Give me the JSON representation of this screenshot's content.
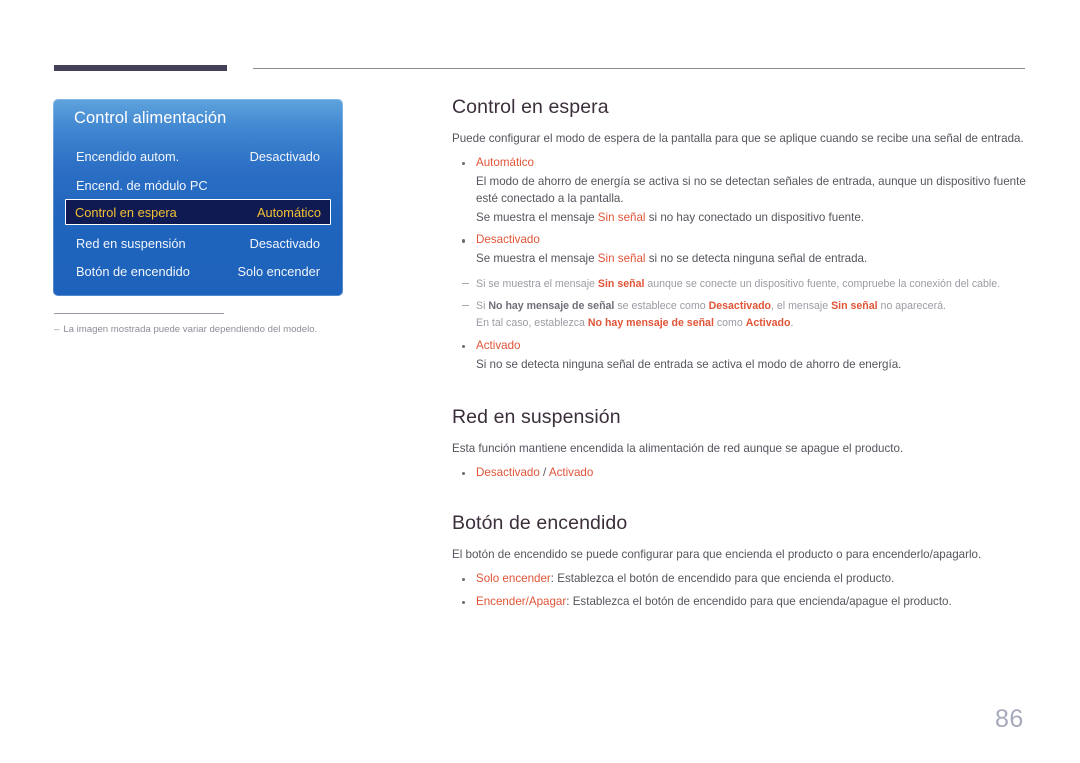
{
  "header": {
    "rule_accent_color": "#434058",
    "rule_line_color": "#8b8b92"
  },
  "osd_panel": {
    "title": "Control alimentación",
    "accent_color": "#1d62bc",
    "selected_background": "#101a52",
    "selected_text_color": "#f2c033",
    "rows": [
      {
        "label": "Encendido autom.",
        "value": "Desactivado",
        "selected": false
      },
      {
        "label": "Encend. de módulo PC",
        "value": "",
        "selected": false
      },
      {
        "label": "Control en espera",
        "value": "Automático",
        "selected": true
      },
      {
        "label": "Red en suspensión",
        "value": "Desactivado",
        "selected": false
      },
      {
        "label": "Botón de encendido",
        "value": "Solo encender",
        "selected": false
      }
    ]
  },
  "figure_caption": {
    "dash": "‒",
    "text": "La imagen mostrada puede variar dependiendo del modelo."
  },
  "sections": [
    {
      "heading": "Control en espera",
      "intro": "Puede configurar el modo de espera de la pantalla para que se aplique cuando se recibe una señal de entrada.",
      "bullets": [
        {
          "term": "Automático",
          "lines": [
            "El modo de ahorro de energía se activa si no se detectan señales de entrada, aunque un dispositivo fuente esté conectado a la pantalla.",
            "Se muestra el mensaje Sin señal si no hay conectado un dispositivo fuente."
          ],
          "line2_prefix": "Se muestra el mensaje ",
          "line2_highlight": "Sin señal",
          "line2_suffix": " si no hay conectado un dispositivo fuente."
        },
        {
          "term": "Desactivado",
          "line_prefix": "Se muestra el mensaje ",
          "line_highlight": "Sin señal",
          "line_suffix": " si no se detecta ninguna señal de entrada."
        },
        {
          "term": "Activado",
          "line": "Si no se detecta ninguna señal de entrada se activa el modo de ahorro de energía."
        }
      ],
      "subnotes": [
        {
          "p1": "Si se muestra el mensaje ",
          "s1": "Sin señal",
          "p2": " aunque se conecte un dispositivo fuente, compruebe la conexión del cable."
        },
        {
          "p1": "Si ",
          "s1": "No hay mensaje de señal",
          "p2": " se establece como ",
          "s2": "Desactivado",
          "p3": ", el mensaje ",
          "s3": "Sin señal",
          "p4": " no aparecerá.",
          "l2p1": "En tal caso, establezca ",
          "l2s1": "No hay mensaje de señal",
          "l2p2": " como ",
          "l2s2": "Activado",
          "l2p3": "."
        }
      ]
    },
    {
      "heading": "Red en suspensión",
      "intro": "Esta función mantiene encendida la alimentación de red aunque se apague el producto.",
      "options_line": {
        "option_a": "Desactivado",
        "separator": " / ",
        "option_b": "Activado"
      }
    },
    {
      "heading": "Botón de encendido",
      "intro": "El botón de encendido se puede configurar para que encienda el producto o para encenderlo/apagarlo.",
      "bullets": [
        {
          "term": "Solo encender",
          "desc": ": Establezca el botón de encendido para que encienda el producto."
        },
        {
          "term": "Encender/Apagar",
          "desc": ": Establezca el botón de encendido para que encienda/apague el producto."
        }
      ]
    }
  ],
  "page_number": "86",
  "colors": {
    "accent_orange": "#e05538",
    "heading": "#3c2f3c",
    "body_text": "#55555e",
    "muted_text": "#9b9ba4",
    "page_number": "#a7a9bd"
  }
}
